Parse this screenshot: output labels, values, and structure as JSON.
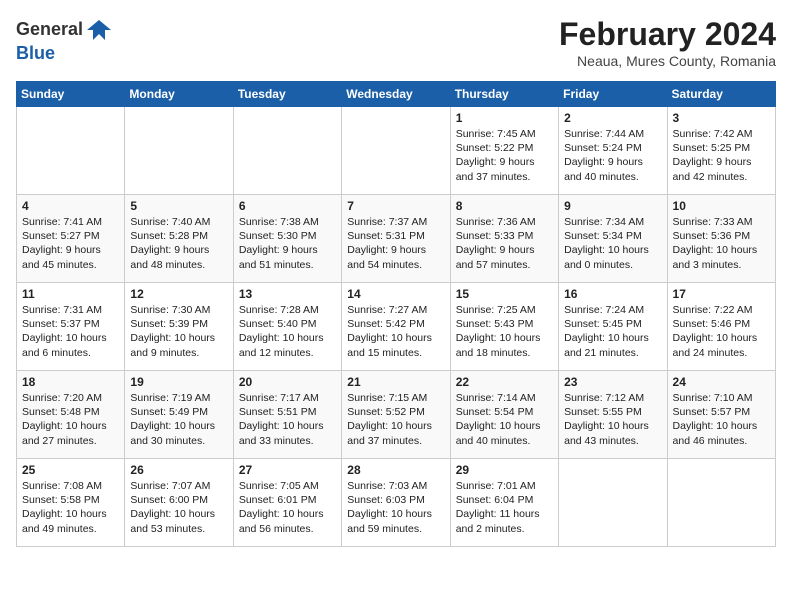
{
  "header": {
    "logo_general": "General",
    "logo_blue": "Blue",
    "month_title": "February 2024",
    "location": "Neaua, Mures County, Romania"
  },
  "days_of_week": [
    "Sunday",
    "Monday",
    "Tuesday",
    "Wednesday",
    "Thursday",
    "Friday",
    "Saturday"
  ],
  "weeks": [
    [
      {
        "day": "",
        "info": ""
      },
      {
        "day": "",
        "info": ""
      },
      {
        "day": "",
        "info": ""
      },
      {
        "day": "",
        "info": ""
      },
      {
        "day": "1",
        "info": "Sunrise: 7:45 AM\nSunset: 5:22 PM\nDaylight: 9 hours\nand 37 minutes."
      },
      {
        "day": "2",
        "info": "Sunrise: 7:44 AM\nSunset: 5:24 PM\nDaylight: 9 hours\nand 40 minutes."
      },
      {
        "day": "3",
        "info": "Sunrise: 7:42 AM\nSunset: 5:25 PM\nDaylight: 9 hours\nand 42 minutes."
      }
    ],
    [
      {
        "day": "4",
        "info": "Sunrise: 7:41 AM\nSunset: 5:27 PM\nDaylight: 9 hours\nand 45 minutes."
      },
      {
        "day": "5",
        "info": "Sunrise: 7:40 AM\nSunset: 5:28 PM\nDaylight: 9 hours\nand 48 minutes."
      },
      {
        "day": "6",
        "info": "Sunrise: 7:38 AM\nSunset: 5:30 PM\nDaylight: 9 hours\nand 51 minutes."
      },
      {
        "day": "7",
        "info": "Sunrise: 7:37 AM\nSunset: 5:31 PM\nDaylight: 9 hours\nand 54 minutes."
      },
      {
        "day": "8",
        "info": "Sunrise: 7:36 AM\nSunset: 5:33 PM\nDaylight: 9 hours\nand 57 minutes."
      },
      {
        "day": "9",
        "info": "Sunrise: 7:34 AM\nSunset: 5:34 PM\nDaylight: 10 hours\nand 0 minutes."
      },
      {
        "day": "10",
        "info": "Sunrise: 7:33 AM\nSunset: 5:36 PM\nDaylight: 10 hours\nand 3 minutes."
      }
    ],
    [
      {
        "day": "11",
        "info": "Sunrise: 7:31 AM\nSunset: 5:37 PM\nDaylight: 10 hours\nand 6 minutes."
      },
      {
        "day": "12",
        "info": "Sunrise: 7:30 AM\nSunset: 5:39 PM\nDaylight: 10 hours\nand 9 minutes."
      },
      {
        "day": "13",
        "info": "Sunrise: 7:28 AM\nSunset: 5:40 PM\nDaylight: 10 hours\nand 12 minutes."
      },
      {
        "day": "14",
        "info": "Sunrise: 7:27 AM\nSunset: 5:42 PM\nDaylight: 10 hours\nand 15 minutes."
      },
      {
        "day": "15",
        "info": "Sunrise: 7:25 AM\nSunset: 5:43 PM\nDaylight: 10 hours\nand 18 minutes."
      },
      {
        "day": "16",
        "info": "Sunrise: 7:24 AM\nSunset: 5:45 PM\nDaylight: 10 hours\nand 21 minutes."
      },
      {
        "day": "17",
        "info": "Sunrise: 7:22 AM\nSunset: 5:46 PM\nDaylight: 10 hours\nand 24 minutes."
      }
    ],
    [
      {
        "day": "18",
        "info": "Sunrise: 7:20 AM\nSunset: 5:48 PM\nDaylight: 10 hours\nand 27 minutes."
      },
      {
        "day": "19",
        "info": "Sunrise: 7:19 AM\nSunset: 5:49 PM\nDaylight: 10 hours\nand 30 minutes."
      },
      {
        "day": "20",
        "info": "Sunrise: 7:17 AM\nSunset: 5:51 PM\nDaylight: 10 hours\nand 33 minutes."
      },
      {
        "day": "21",
        "info": "Sunrise: 7:15 AM\nSunset: 5:52 PM\nDaylight: 10 hours\nand 37 minutes."
      },
      {
        "day": "22",
        "info": "Sunrise: 7:14 AM\nSunset: 5:54 PM\nDaylight: 10 hours\nand 40 minutes."
      },
      {
        "day": "23",
        "info": "Sunrise: 7:12 AM\nSunset: 5:55 PM\nDaylight: 10 hours\nand 43 minutes."
      },
      {
        "day": "24",
        "info": "Sunrise: 7:10 AM\nSunset: 5:57 PM\nDaylight: 10 hours\nand 46 minutes."
      }
    ],
    [
      {
        "day": "25",
        "info": "Sunrise: 7:08 AM\nSunset: 5:58 PM\nDaylight: 10 hours\nand 49 minutes."
      },
      {
        "day": "26",
        "info": "Sunrise: 7:07 AM\nSunset: 6:00 PM\nDaylight: 10 hours\nand 53 minutes."
      },
      {
        "day": "27",
        "info": "Sunrise: 7:05 AM\nSunset: 6:01 PM\nDaylight: 10 hours\nand 56 minutes."
      },
      {
        "day": "28",
        "info": "Sunrise: 7:03 AM\nSunset: 6:03 PM\nDaylight: 10 hours\nand 59 minutes."
      },
      {
        "day": "29",
        "info": "Sunrise: 7:01 AM\nSunset: 6:04 PM\nDaylight: 11 hours\nand 2 minutes."
      },
      {
        "day": "",
        "info": ""
      },
      {
        "day": "",
        "info": ""
      }
    ]
  ]
}
